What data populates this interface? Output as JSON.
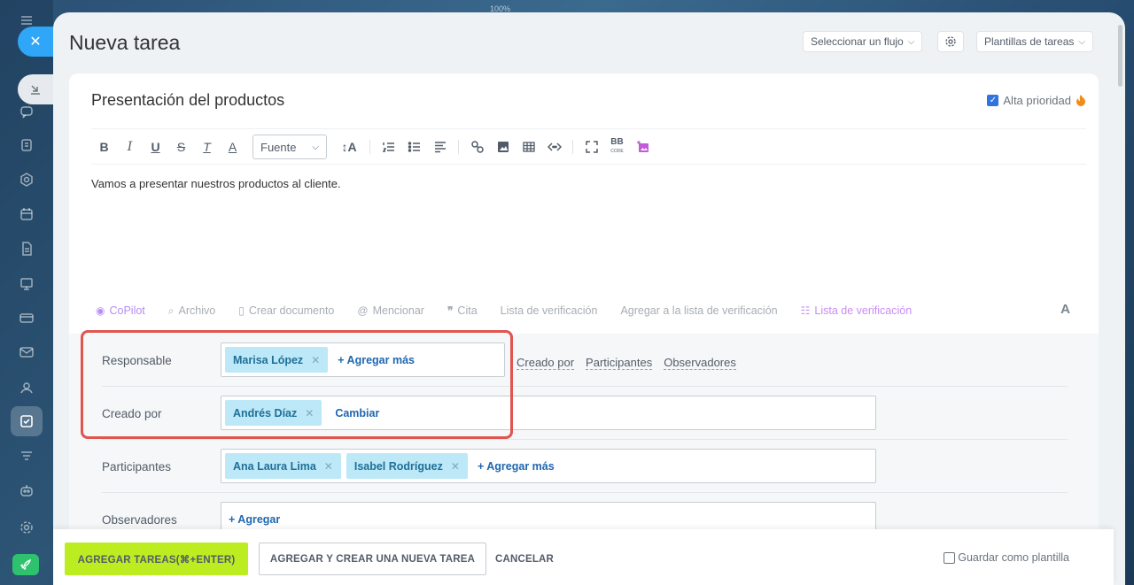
{
  "zoom": "100%",
  "header": {
    "title": "Nueva tarea",
    "flow_select": "Seleccionar un flujo",
    "templates_select": "Plantillas de tareas"
  },
  "task": {
    "title": "Presentación del productos",
    "high_priority_label": "Alta prioridad",
    "high_priority_checked": true,
    "description": "Vamos a presentar nuestros productos al cliente."
  },
  "toolbar": {
    "bold": "B",
    "italic": "I",
    "underline": "U",
    "strike": "S",
    "clear": "T",
    "color": "A",
    "font_select": "Fuente",
    "font_size": "↕A",
    "bbcode": "BB"
  },
  "attachments": {
    "copilot": "CoPilot",
    "file": "Archivo",
    "create_doc": "Crear documento",
    "mention": "Mencionar",
    "quote": "Cita",
    "checklist": "Lista de verificación",
    "add_to_checklist": "Agregar a la lista de verificación",
    "checklist_new": "Lista de verificación",
    "font_toggle": "A"
  },
  "roles": {
    "responsible": {
      "label": "Responsable",
      "people": [
        "Marisa López"
      ],
      "add": "+ Agregar más"
    },
    "links": [
      "Creado por",
      "Participantes",
      "Observadores"
    ],
    "created_by": {
      "label": "Creado por",
      "people": [
        "Andrés Díaz"
      ],
      "change": "Cambiar"
    },
    "participants": {
      "label": "Participantes",
      "people": [
        "Ana Laura Lima",
        "Isabel Rodríguez"
      ],
      "add": "+ Agregar más"
    },
    "observers": {
      "label": "Observadores",
      "add": "+ Agregar"
    }
  },
  "footer": {
    "add_tasks": "AGREGAR TAREAS(⌘+ENTER)",
    "add_and_new": "AGREGAR Y CREAR UNA NUEVA TAREA",
    "cancel": "CANCELAR",
    "save_template": "Guardar como plantilla",
    "save_template_checked": false
  },
  "colors": {
    "accent_blue": "#2fa6f7",
    "primary_button": "#bbed21",
    "chip_bg": "#bce8f8",
    "highlight": "#e0554f",
    "rocket": "#2fc26e"
  }
}
